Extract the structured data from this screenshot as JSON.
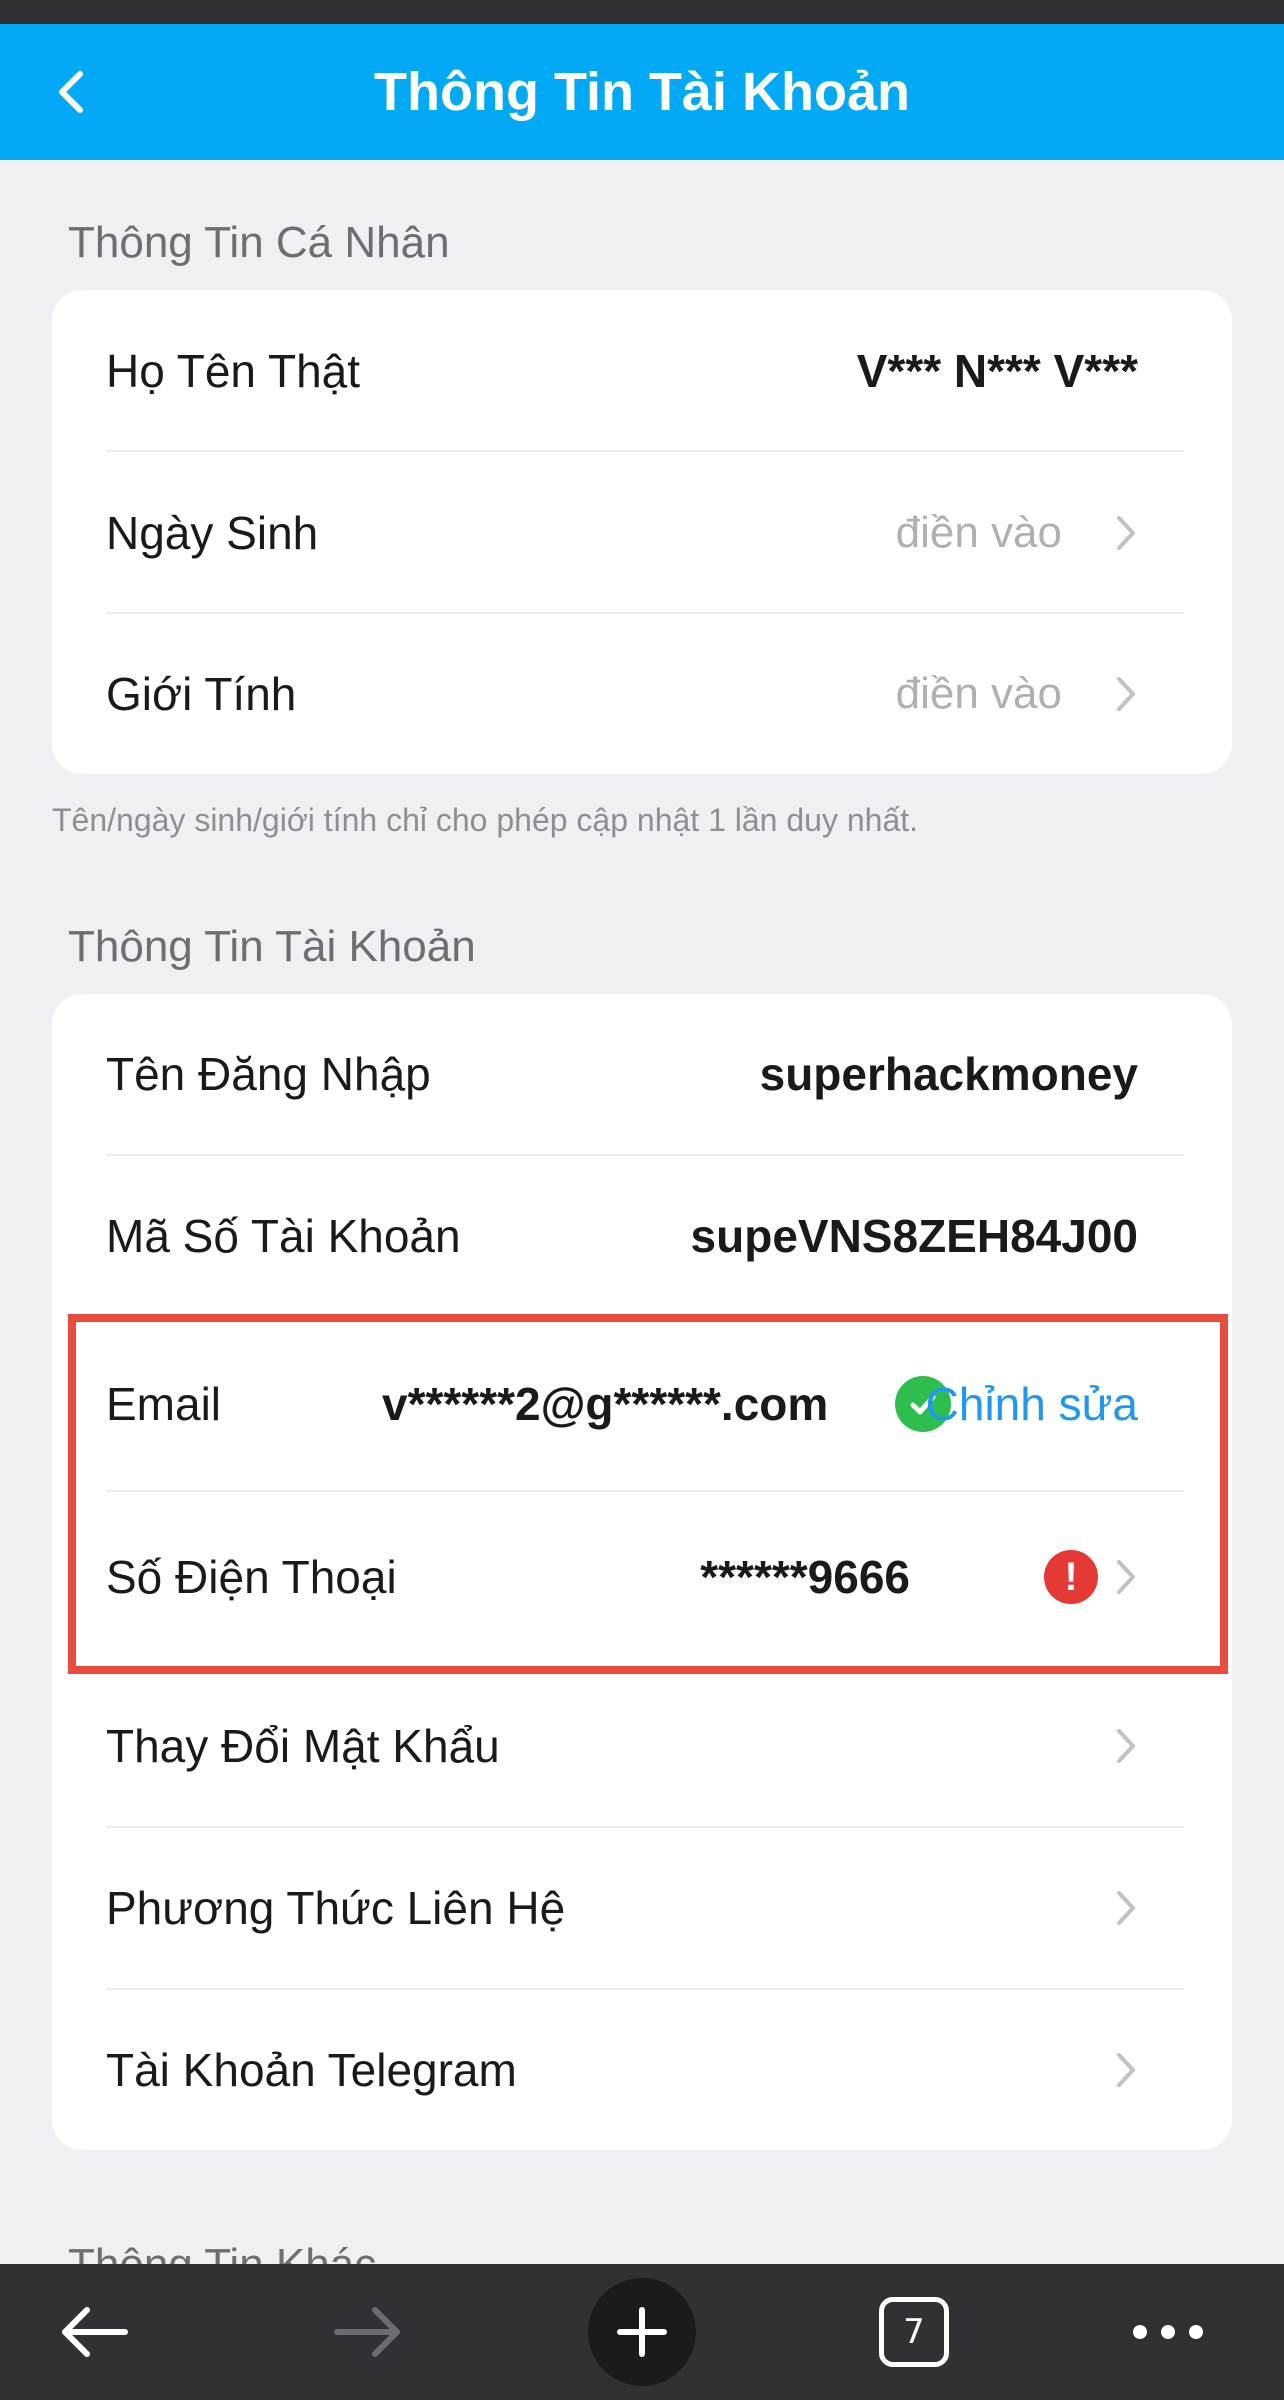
{
  "header": {
    "title": "Thông Tin Tài Khoản"
  },
  "personal": {
    "section_title": "Thông Tin Cá Nhân",
    "rows": [
      {
        "label": "Họ Tên Thật",
        "value": "V*** N*** V***"
      },
      {
        "label": "Ngày Sinh",
        "placeholder": "điền vào"
      },
      {
        "label": "Giới Tính",
        "placeholder": "điền vào"
      }
    ],
    "note": "Tên/ngày sinh/giới tính chỉ cho phép cập nhật 1 lần duy nhất."
  },
  "account": {
    "section_title": "Thông Tin Tài Khoản",
    "username": {
      "label": "Tên Đăng Nhập",
      "value": "superhackmoney"
    },
    "account_id": {
      "label": "Mã Số Tài Khoản",
      "value": "supeVNS8ZEH84J00"
    },
    "email": {
      "label": "Email",
      "value": "v******2@g******.com",
      "action": "Chỉnh sửa"
    },
    "phone": {
      "label": "Số Điện Thoại",
      "value": "******9666"
    },
    "change_password": {
      "label": "Thay Đổi Mật Khẩu"
    },
    "contact_method": {
      "label": "Phương Thức Liên Hệ"
    },
    "telegram": {
      "label": "Tài Khoản Telegram"
    }
  },
  "other": {
    "section_title": "Thông Tin Khác"
  },
  "browser_bar": {
    "tab_count": "7"
  },
  "colors": {
    "header": "#03A9F4",
    "verified": "#2DBE4E",
    "warning": "#E53935",
    "link": "#2196F3",
    "highlight": "#E84C3D"
  }
}
